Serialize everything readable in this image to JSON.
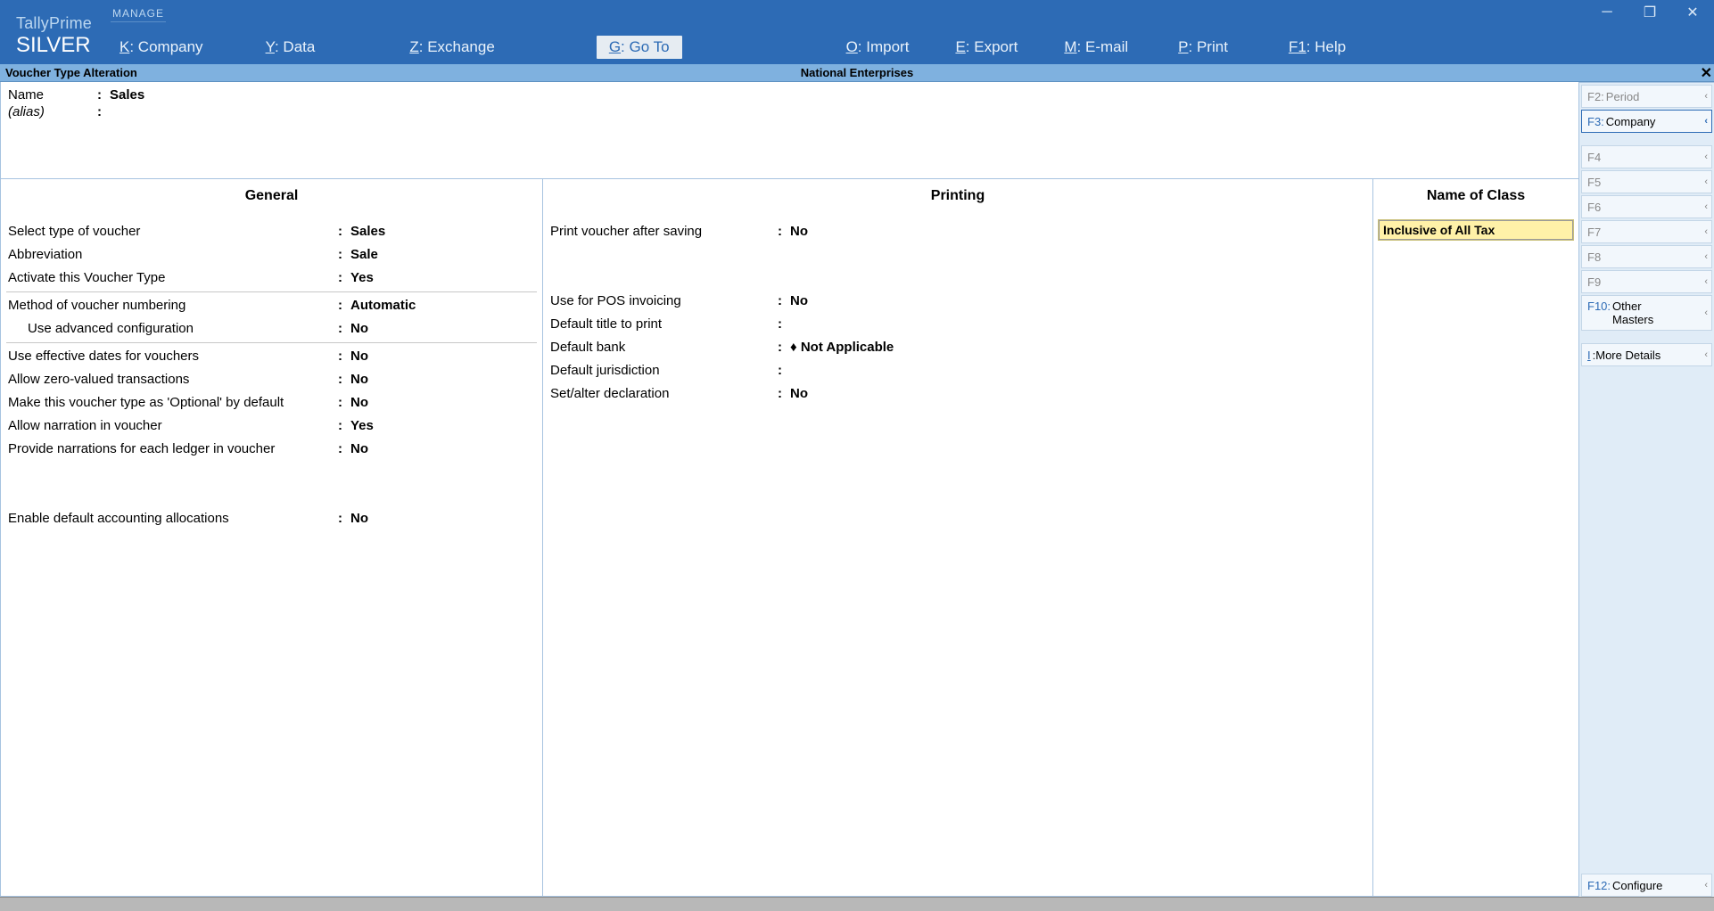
{
  "app": {
    "logo_top": "TallyPrime",
    "logo_bottom": "SILVER",
    "manage_label": "MANAGE"
  },
  "top_menu": {
    "company": {
      "key": "K",
      "label": "Company"
    },
    "data": {
      "key": "Y",
      "label": "Data"
    },
    "exchange": {
      "key": "Z",
      "label": "Exchange"
    },
    "goto": {
      "key": "G",
      "label": "Go To"
    },
    "import": {
      "key": "O",
      "label": "Import"
    },
    "export": {
      "key": "E",
      "label": "Export"
    },
    "email": {
      "key": "M",
      "label": "E-mail"
    },
    "print": {
      "key": "P",
      "label": "Print"
    },
    "help": {
      "key": "F1",
      "label": "Help"
    }
  },
  "sub_header": {
    "left": "Voucher Type Alteration",
    "center": "National Enterprises"
  },
  "voucher": {
    "name_label": "Name",
    "name_value": "Sales",
    "alias_label": "(alias)",
    "alias_value": ""
  },
  "columns": {
    "general_head": "General",
    "printing_head": "Printing",
    "class_head": "Name of Class"
  },
  "general": {
    "type_label": "Select type of voucher",
    "type_value": "Sales",
    "abbr_label": "Abbreviation",
    "abbr_value": "Sale",
    "activate_label": "Activate this Voucher Type",
    "activate_value": "Yes",
    "method_label": "Method of voucher numbering",
    "method_value": "Automatic",
    "advcfg_label": "Use advanced configuration",
    "advcfg_value": "No",
    "effdates_label": "Use effective dates for vouchers",
    "effdates_value": "No",
    "zero_label": "Allow zero-valued transactions",
    "zero_value": "No",
    "optional_label": "Make this voucher type as 'Optional' by default",
    "optional_value": "No",
    "narr_label": "Allow narration in voucher",
    "narr_value": "Yes",
    "narr_each_label": "Provide narrations for each ledger in voucher",
    "narr_each_value": "No",
    "alloc_label": "Enable default accounting allocations",
    "alloc_value": "No"
  },
  "printing": {
    "after_save_label": "Print voucher after saving",
    "after_save_value": "No",
    "pos_label": "Use for POS invoicing",
    "pos_value": "No",
    "title_label": "Default title to print",
    "title_value": "",
    "bank_label": "Default bank",
    "bank_value": "♦ Not Applicable",
    "juris_label": "Default jurisdiction",
    "juris_value": "",
    "decl_label": "Set/alter declaration",
    "decl_value": "No"
  },
  "class_entry": "Inclusive of All Tax",
  "right": {
    "f2": "Period",
    "f3": "Company",
    "f4": "",
    "f5": "",
    "f6": "",
    "f7": "",
    "f8": "",
    "f9": "",
    "f10_line1": "Other",
    "f10_line2": "Masters",
    "more_key": "I",
    "more_label": "More Details",
    "f12": "Configure"
  }
}
